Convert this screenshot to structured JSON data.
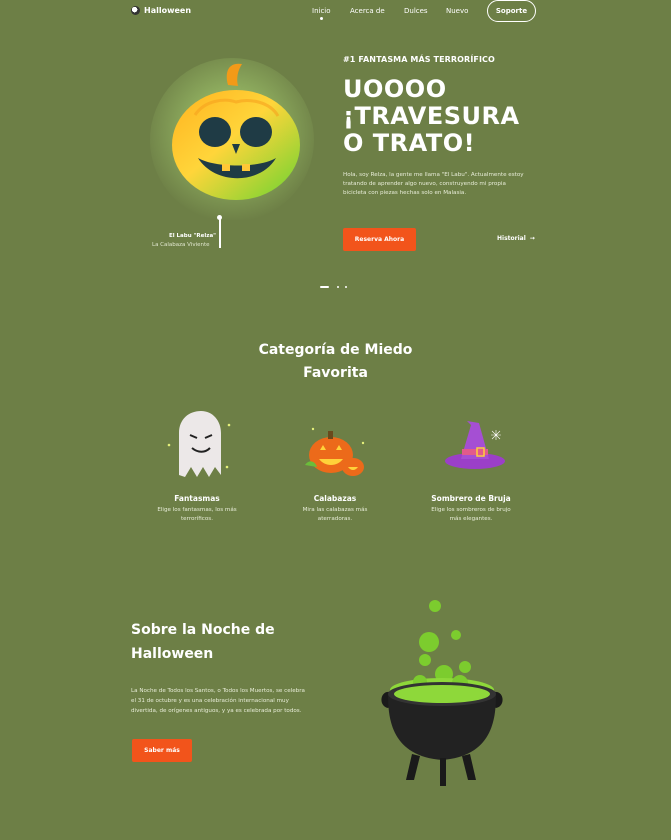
{
  "nav": {
    "logo_text": "Halloween",
    "links": [
      "Inicio",
      "Acerca de",
      "Dulces",
      "Nuevo"
    ],
    "support_label": "Soporte"
  },
  "hero": {
    "tag": "#1 FANTASMA MÁS TERRORÍFICO",
    "title_line1": "UOOOO",
    "title_line2": "¡TRAVESURA",
    "title_line3": "O TRATO!",
    "description": "Hola, soy Relza, la gente me llama \"El Labu\". Actualmente estoy tratando de aprender algo nuevo, construyendo mi propia bicicleta con piezas hechas solo en Malasia.",
    "reserve_label": "Reserva Ahora",
    "history_label": "Historial",
    "caption_name": "El Labu \"Relza\"",
    "caption_sub": "La Calabaza Viviente"
  },
  "categories": {
    "title_line1": "Categoría de Miedo",
    "title_line2": "Favorita",
    "items": [
      {
        "name": "Fantasmas",
        "desc": "Elige los fantasmas, los más terroríficos."
      },
      {
        "name": "Calabazas",
        "desc": "Mira las calabazas más aterradoras."
      },
      {
        "name": "Sombrero de Bruja",
        "desc": "Elige los sombreros de brujo más elegantes."
      }
    ]
  },
  "about": {
    "title_line1": "Sobre la Noche de",
    "title_line2": "Halloween",
    "description": "La Noche de Todos los Santos, o Todos los Muertos, se celebra el 31 de octubre y es una celebración internacional muy divertida, de orígenes antiguos, y ya es celebrada por todos.",
    "button_label": "Saber más"
  },
  "colors": {
    "background": "#6d7f46",
    "accent": "#f2541b",
    "text": "#ffffff"
  },
  "icons": [
    "skull-icon",
    "arrow-right-icon",
    "ghost-icon",
    "pumpkin-icon",
    "witch-hat-icon",
    "cauldron-icon"
  ]
}
